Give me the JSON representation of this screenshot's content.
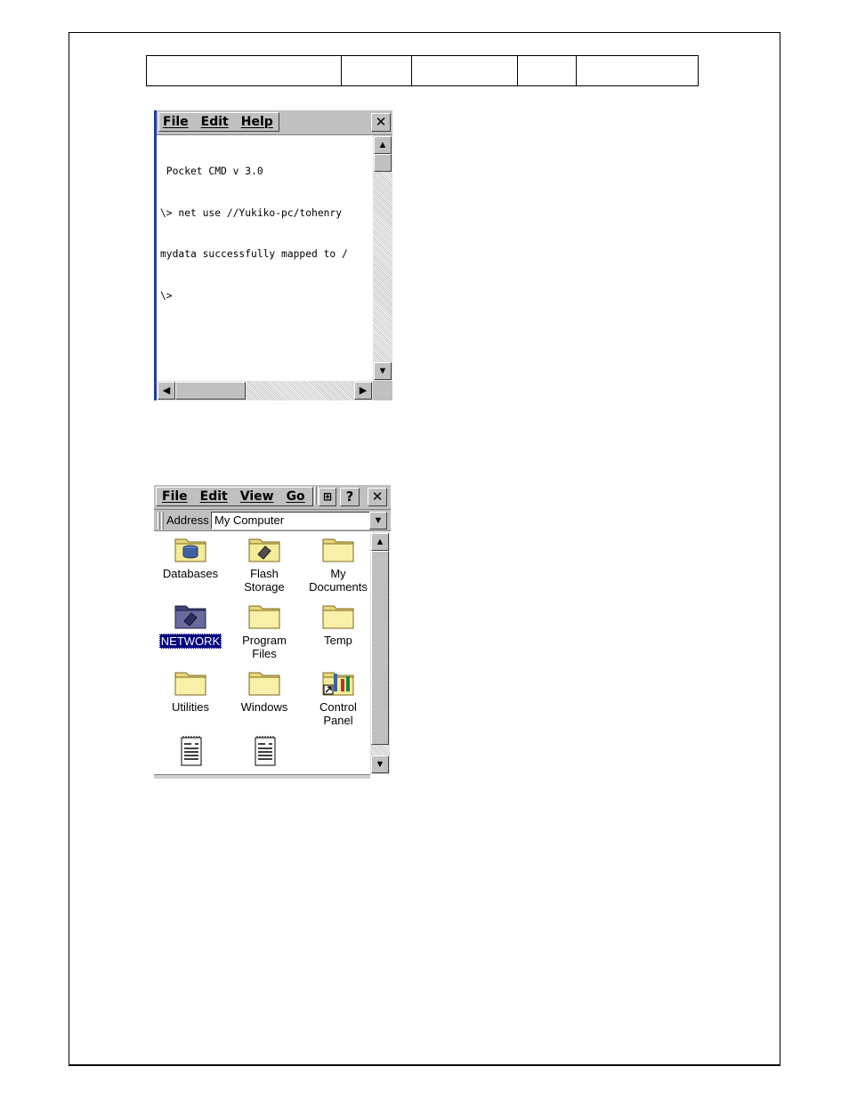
{
  "pocket_cmd": {
    "menus": [
      "File",
      "Edit",
      "Help"
    ],
    "close_glyph": "✕",
    "lines": [
      " Pocket CMD v 3.0",
      "\\> net use //Yukiko-pc/tohenry",
      "mydata successfully mapped to /",
      "\\>"
    ]
  },
  "explorer": {
    "menus": [
      "File",
      "Edit",
      "View",
      "Go"
    ],
    "help_glyph": "?",
    "close_glyph": "✕",
    "address_label": "Address",
    "address_value": "My Computer",
    "items": [
      {
        "label": "Databases",
        "icon": "database-folder-icon"
      },
      {
        "label": "Flash\nStorage",
        "icon": "flash-storage-icon"
      },
      {
        "label": "My\nDocuments",
        "icon": "folder-icon"
      },
      {
        "label": "NETWORK",
        "icon": "network-folder-icon",
        "selected": true
      },
      {
        "label": "Program\nFiles",
        "icon": "folder-icon"
      },
      {
        "label": "Temp",
        "icon": "folder-icon"
      },
      {
        "label": "Utilities",
        "icon": "folder-icon"
      },
      {
        "label": "Windows",
        "icon": "folder-icon"
      },
      {
        "label": "Control\nPanel",
        "icon": "control-panel-icon"
      },
      {
        "label": "",
        "icon": "document-icon"
      },
      {
        "label": "",
        "icon": "document-icon"
      }
    ]
  }
}
